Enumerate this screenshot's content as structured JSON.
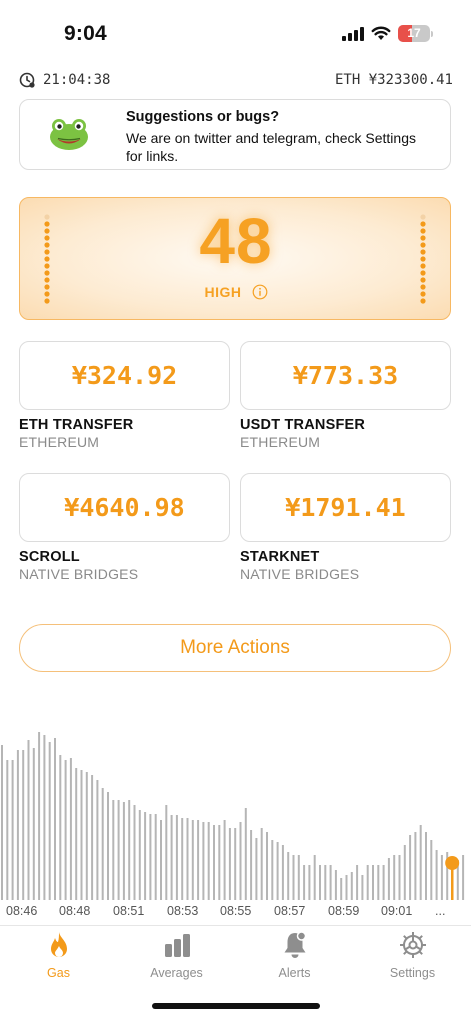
{
  "status_bar": {
    "time": "9:04",
    "battery_level": "17"
  },
  "info": {
    "clock": "21:04:38",
    "eth_price": "ETH ¥323300.41"
  },
  "suggestion": {
    "title": "Suggestions or bugs?",
    "body": "We are on twitter and telegram, check Settings for links."
  },
  "gauge": {
    "value": "48",
    "level": "HIGH"
  },
  "tiles": [
    {
      "price": "¥324.92",
      "name": "ETH TRANSFER",
      "network": "ETHEREUM"
    },
    {
      "price": "¥773.33",
      "name": "USDT TRANSFER",
      "network": "ETHEREUM"
    },
    {
      "price": "¥4640.98",
      "name": "SCROLL",
      "network": "NATIVE BRIDGES"
    },
    {
      "price": "¥1791.41",
      "name": "STARKNET",
      "network": "NATIVE BRIDGES"
    }
  ],
  "more_actions_label": "More Actions",
  "chart_data": {
    "type": "bar",
    "x_tick_labels": [
      "08:46",
      "08:48",
      "08:51",
      "08:53",
      "08:55",
      "08:57",
      "08:59",
      "09:01",
      "..."
    ],
    "values": [
      155,
      140,
      140,
      150,
      150,
      160,
      152,
      168,
      165,
      158,
      162,
      145,
      140,
      142,
      132,
      130,
      128,
      125,
      120,
      112,
      108,
      100,
      100,
      98,
      100,
      95,
      90,
      88,
      86,
      86,
      80,
      95,
      85,
      85,
      82,
      82,
      80,
      80,
      78,
      78,
      75,
      75,
      80,
      72,
      72,
      78,
      92,
      70,
      62,
      72,
      68,
      60,
      58,
      55,
      48,
      45,
      45,
      35,
      35,
      45,
      35,
      35,
      35,
      30,
      22,
      25,
      28,
      35,
      25,
      35,
      35,
      35,
      35,
      42,
      45,
      45,
      55,
      65,
      68,
      75,
      68,
      60,
      50,
      45,
      48,
      35,
      40,
      45
    ],
    "highlight_last": true,
    "accent": "#f39a1a",
    "bar_color": "#b5b5b5"
  },
  "tab_bar": [
    {
      "label": "Gas",
      "icon": "flame-icon",
      "active": true
    },
    {
      "label": "Averages",
      "icon": "bar-chart-icon",
      "active": false
    },
    {
      "label": "Alerts",
      "icon": "bell-icon",
      "active": false
    },
    {
      "label": "Settings",
      "icon": "gear-icon",
      "active": false
    }
  ],
  "colors": {
    "accent": "#f39a1a",
    "gauge_glow": "#f6a123",
    "muted": "#8a8a8a"
  }
}
